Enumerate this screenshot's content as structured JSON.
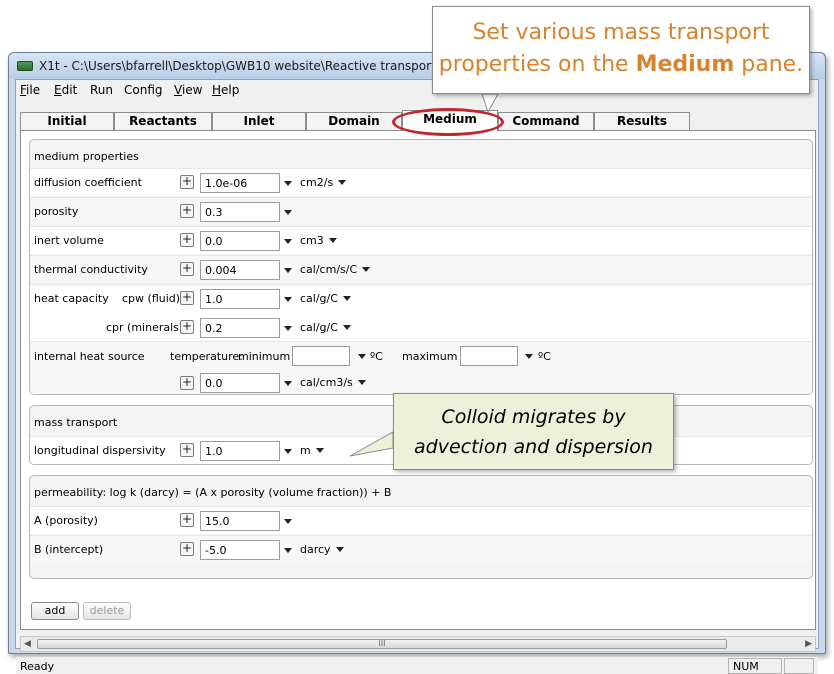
{
  "window": {
    "title": "X1t - C:\\Users\\bfarrell\\Desktop\\GWB10 website\\Reactive transport"
  },
  "menu": [
    "File",
    "Edit",
    "Run",
    "Config",
    "View",
    "Help"
  ],
  "tabs": [
    "Initial",
    "Reactants",
    "Inlet",
    "Domain",
    "Medium",
    "Command",
    "Results"
  ],
  "active_tab": "Medium",
  "medium_properties": {
    "header": "medium properties",
    "diffusion": {
      "label": "diffusion coefficient",
      "value": "1.0e-06",
      "unit": "cm2/s"
    },
    "porosity": {
      "label": "porosity",
      "value": "0.3"
    },
    "inert_volume": {
      "label": "inert volume",
      "value": "0.0",
      "unit": "cm3"
    },
    "thermal_conductivity": {
      "label": "thermal conductivity",
      "value": "0.004",
      "unit": "cal/cm/s/C"
    },
    "heat_capacity": {
      "label": "heat capacity",
      "cpw_label": "cpw (fluid)",
      "cpw_value": "1.0",
      "cpw_unit": "cal/g/C",
      "cpr_label": "cpr (minerals)",
      "cpr_value": "0.2",
      "cpr_unit": "cal/g/C"
    },
    "internal_heat": {
      "label": "internal heat source",
      "temp_label": "temperature:",
      "min_label": "minimum",
      "max_label": "maximum",
      "deg_unit": "ºC",
      "value": "0.0",
      "unit": "cal/cm3/s"
    }
  },
  "mass_transport": {
    "header": "mass transport",
    "dispersivity": {
      "label": "longitudinal dispersivity",
      "value": "1.0",
      "unit": "m"
    }
  },
  "permeability": {
    "header": "permeability: log k (darcy) = (A x porosity (volume fraction)) + B",
    "a": {
      "label": "A (porosity)",
      "value": "15.0"
    },
    "b": {
      "label": "B (intercept)",
      "value": "-5.0",
      "unit": "darcy"
    }
  },
  "buttons": {
    "add": "add",
    "delete": "delete"
  },
  "scroll_grip": "III",
  "status": {
    "text": "Ready",
    "num": "NUM"
  },
  "callouts": {
    "top_pre": "Set various mass transport properties on the ",
    "top_bold": "Medium",
    "top_post": " pane.",
    "mid": "Colloid migrates by advection and dispersion"
  },
  "colors": {
    "callout_text": "#d9822b",
    "oval": "#c0262c",
    "callout_mid_bg": "#eef1d9"
  },
  "icons": {
    "plus": "+",
    "dropdown": "triangle-down"
  }
}
